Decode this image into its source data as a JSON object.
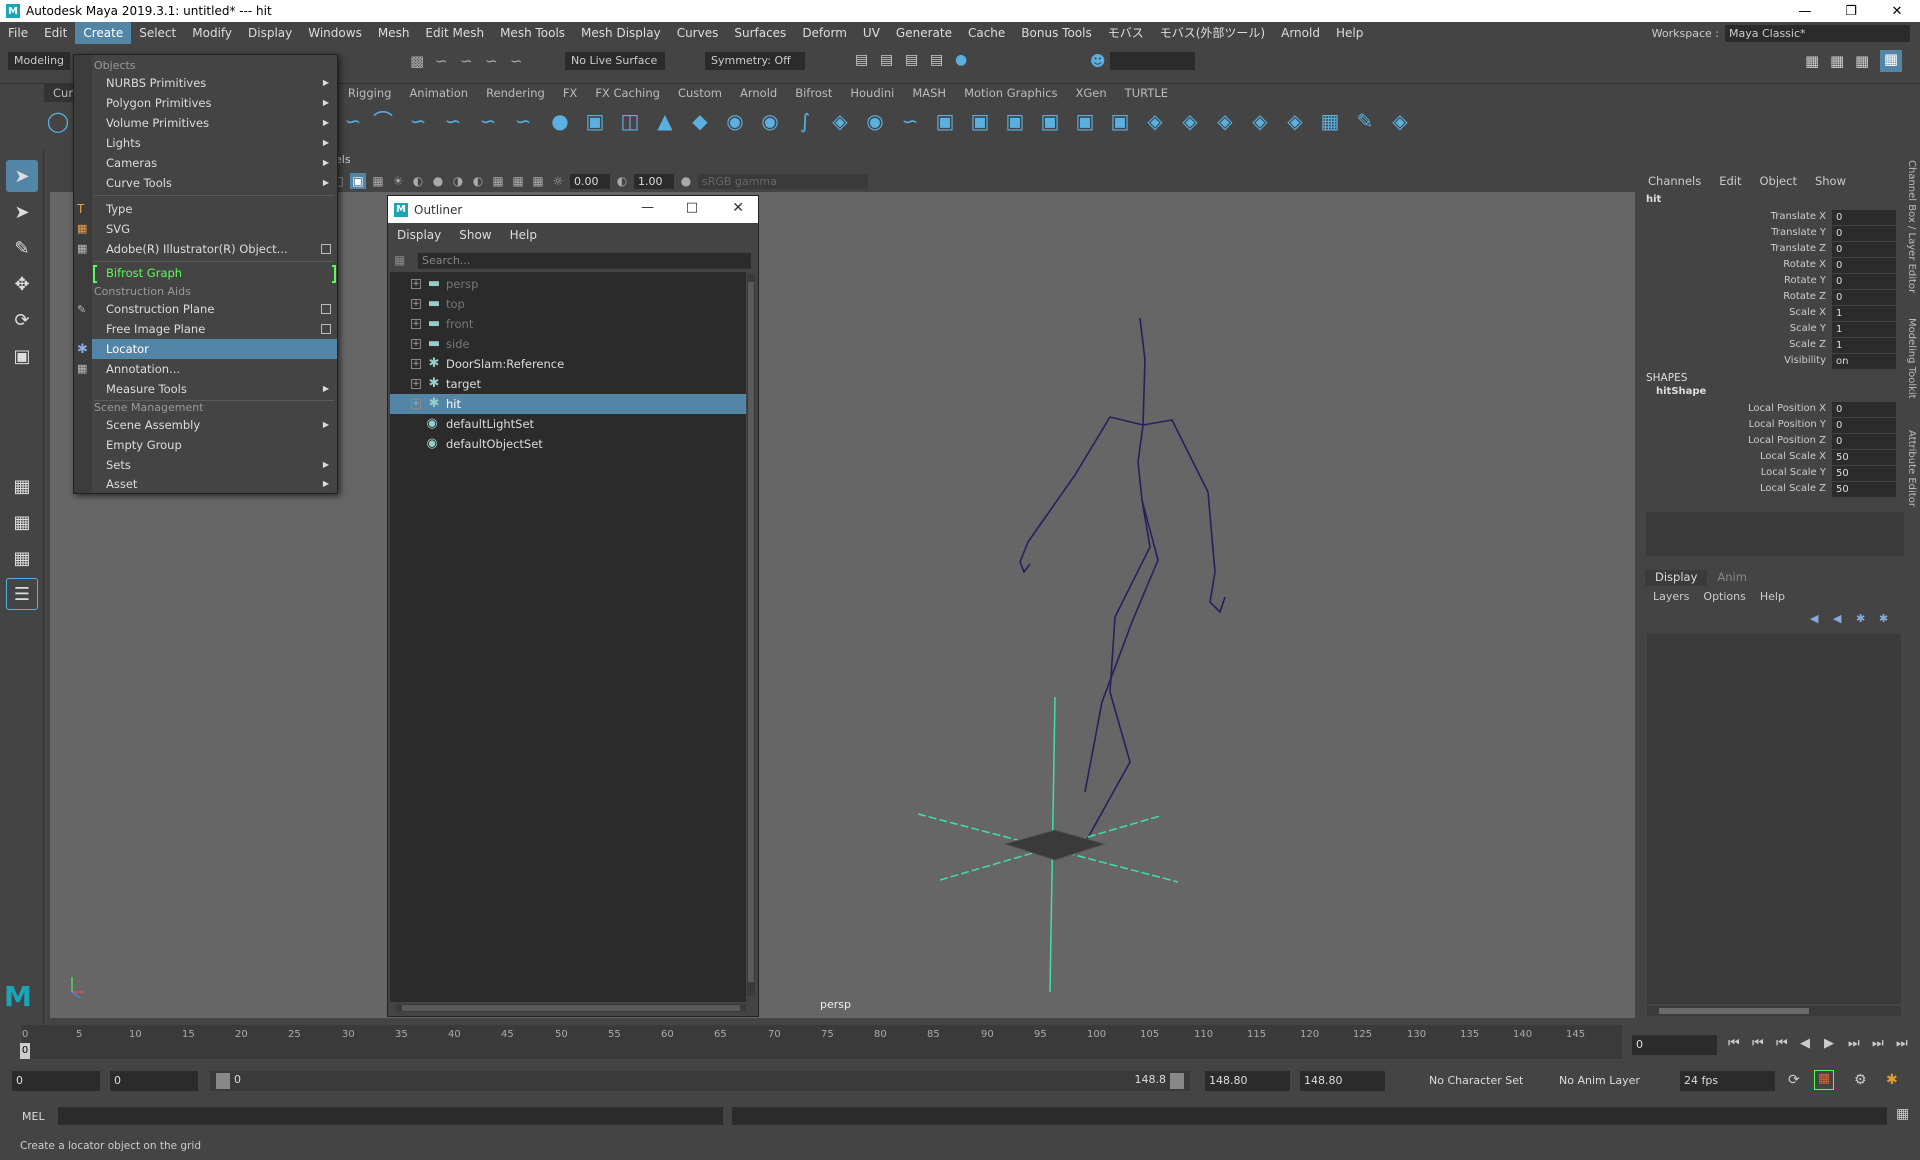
{
  "window": {
    "title": "Autodesk Maya 2019.3.1: untitled*   ---   hit"
  },
  "menubar": [
    "File",
    "Edit",
    "Create",
    "Select",
    "Modify",
    "Display",
    "Windows",
    "Mesh",
    "Edit Mesh",
    "Mesh Tools",
    "Mesh Display",
    "Curves",
    "Surfaces",
    "Deform",
    "UV",
    "Generate",
    "Cache",
    "Bonus Tools",
    "モバス",
    "モバス(外部ツール)",
    "Arnold",
    "Help"
  ],
  "workspace": {
    "label": "Workspace :",
    "value": "Maya Classic*"
  },
  "statusline": {
    "mode": "Modeling",
    "live_surface": "No Live Surface",
    "symmetry": "Symmetry: Off"
  },
  "shelf_tabs": [
    "Curv",
    "Rigging",
    "Animation",
    "Rendering",
    "FX",
    "FX Caching",
    "Custom",
    "Arnold",
    "Bifrost",
    "Houdini",
    "MASH",
    "Motion Graphics",
    "XGen",
    "TURTLE"
  ],
  "create_menu": {
    "sections": {
      "objects": "Objects",
      "construction": "Construction Aids",
      "scene": "Scene Management"
    },
    "items": {
      "nurbs": "NURBS Primitives",
      "polygon": "Polygon Primitives",
      "volume": "Volume Primitives",
      "lights": "Lights",
      "cameras": "Cameras",
      "curve_tools": "Curve Tools",
      "type": "Type",
      "svg": "SVG",
      "adobe": "Adobe(R) Illustrator(R) Object...",
      "bifrost": "Bifrost Graph",
      "construction_plane": "Construction Plane",
      "free_image_plane": "Free Image Plane",
      "locator": "Locator",
      "annotation": "Annotation...",
      "measure": "Measure Tools",
      "scene_assembly": "Scene Assembly",
      "empty_group": "Empty Group",
      "sets": "Sets",
      "asset": "Asset"
    }
  },
  "viewport": {
    "exposure": "0.00",
    "gamma": "1.00",
    "color_space": "sRGB gamma",
    "camera_label": "persp",
    "panel_menu_partial": "els"
  },
  "outliner": {
    "title": "Outliner",
    "menu": [
      "Display",
      "Show",
      "Help"
    ],
    "search_placeholder": "Search...",
    "rows": [
      "persp",
      "top",
      "front",
      "side",
      "DoorSlam:Reference",
      "target",
      "hit",
      "defaultLightSet",
      "defaultObjectSet"
    ]
  },
  "channelbox": {
    "menu": [
      "Channels",
      "Edit",
      "Object",
      "Show"
    ],
    "object": "hit",
    "channels": [
      {
        "name": "Translate X",
        "value": "0"
      },
      {
        "name": "Translate Y",
        "value": "0"
      },
      {
        "name": "Translate Z",
        "value": "0"
      },
      {
        "name": "Rotate X",
        "value": "0"
      },
      {
        "name": "Rotate Y",
        "value": "0"
      },
      {
        "name": "Rotate Z",
        "value": "0"
      },
      {
        "name": "Scale X",
        "value": "1"
      },
      {
        "name": "Scale Y",
        "value": "1"
      },
      {
        "name": "Scale Z",
        "value": "1"
      },
      {
        "name": "Visibility",
        "value": "on"
      }
    ],
    "shapes_label": "SHAPES",
    "shape_name": "hitShape",
    "shape_channels": [
      {
        "name": "Local Position X",
        "value": "0"
      },
      {
        "name": "Local Position Y",
        "value": "0"
      },
      {
        "name": "Local Position Z",
        "value": "0"
      },
      {
        "name": "Local Scale X",
        "value": "50"
      },
      {
        "name": "Local Scale Y",
        "value": "50"
      },
      {
        "name": "Local Scale Z",
        "value": "50"
      }
    ],
    "side_tabs": [
      "Channel Box / Layer Editor",
      "Modeling Toolkit",
      "Attribute Editor"
    ]
  },
  "layer_editor": {
    "tabs": [
      "Display",
      "Anim"
    ],
    "menu": [
      "Layers",
      "Options",
      "Help"
    ]
  },
  "timeline": {
    "ticks": [
      "0",
      "5",
      "10",
      "15",
      "20",
      "25",
      "30",
      "35",
      "40",
      "45",
      "50",
      "55",
      "60",
      "65",
      "70",
      "75",
      "80",
      "85",
      "90",
      "95",
      "100",
      "105",
      "110",
      "115",
      "120",
      "125",
      "130",
      "135",
      "140",
      "145"
    ],
    "current_frame": "0",
    "current_frame_field": "0",
    "range_start": "0",
    "playback_start": "0",
    "slider_start": "0",
    "slider_end": "148.8",
    "playback_end": "148.80",
    "range_end": "148.80",
    "character_set": "No Character Set",
    "anim_layer": "No Anim Layer",
    "fps": "24 fps"
  },
  "cmdline": {
    "lang": "MEL"
  },
  "helpline": {
    "text": "Create a locator object on the grid"
  },
  "colors": {
    "accent": "#5285a6",
    "bifrost": "#55ff55",
    "skeleton": "#2a1e5c",
    "locator": "#40e0a0"
  }
}
